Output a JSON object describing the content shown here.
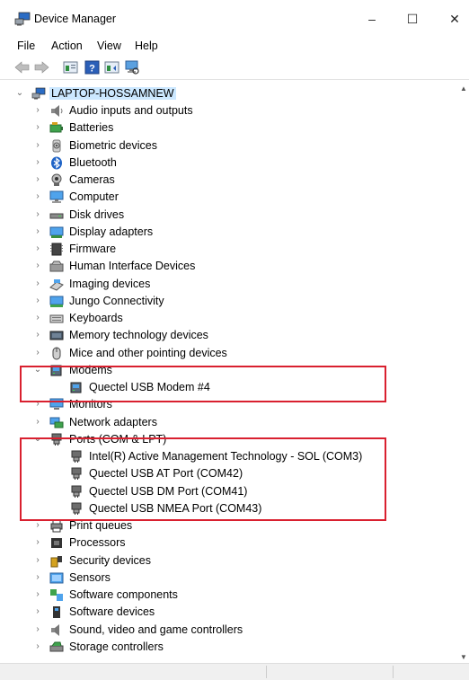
{
  "window": {
    "title": "Device Manager"
  },
  "menu": [
    "File",
    "Action",
    "View",
    "Help"
  ],
  "tree": {
    "root": "LAPTOP-HOSSAMNEW",
    "categories": [
      {
        "label": "Audio inputs and outputs",
        "icon": "speaker-icon"
      },
      {
        "label": "Batteries",
        "icon": "battery-icon"
      },
      {
        "label": "Biometric devices",
        "icon": "biometric-icon"
      },
      {
        "label": "Bluetooth",
        "icon": "bluetooth-icon"
      },
      {
        "label": "Cameras",
        "icon": "camera-icon"
      },
      {
        "label": "Computer",
        "icon": "computer-icon"
      },
      {
        "label": "Disk drives",
        "icon": "disk-drive-icon"
      },
      {
        "label": "Display adapters",
        "icon": "display-adapter-icon"
      },
      {
        "label": "Firmware",
        "icon": "firmware-icon"
      },
      {
        "label": "Human Interface Devices",
        "icon": "hid-icon"
      },
      {
        "label": "Imaging devices",
        "icon": "imaging-icon"
      },
      {
        "label": "Jungo Connectivity",
        "icon": "jungo-icon"
      },
      {
        "label": "Keyboards",
        "icon": "keyboard-icon"
      },
      {
        "label": "Memory technology devices",
        "icon": "memory-icon"
      },
      {
        "label": "Mice and other pointing devices",
        "icon": "mouse-icon"
      },
      {
        "label": "Modems",
        "icon": "modem-icon",
        "expanded": true,
        "children": [
          {
            "label": "Quectel USB Modem #4",
            "icon": "modem-icon"
          }
        ]
      },
      {
        "label": "Monitors",
        "icon": "monitor-icon"
      },
      {
        "label": "Network adapters",
        "icon": "network-adapter-icon"
      },
      {
        "label": "Ports (COM & LPT)",
        "icon": "port-icon",
        "expanded": true,
        "children": [
          {
            "label": "Intel(R) Active Management Technology - SOL (COM3)",
            "icon": "port-icon"
          },
          {
            "label": "Quectel USB AT Port (COM42)",
            "icon": "port-icon"
          },
          {
            "label": "Quectel USB DM Port (COM41)",
            "icon": "port-icon"
          },
          {
            "label": "Quectel USB NMEA Port (COM43)",
            "icon": "port-icon"
          }
        ]
      },
      {
        "label": "Print queues",
        "icon": "printer-icon"
      },
      {
        "label": "Processors",
        "icon": "processor-icon"
      },
      {
        "label": "Security devices",
        "icon": "security-icon"
      },
      {
        "label": "Sensors",
        "icon": "sensor-icon"
      },
      {
        "label": "Software components",
        "icon": "software-component-icon"
      },
      {
        "label": "Software devices",
        "icon": "software-device-icon"
      },
      {
        "label": "Sound, video and game controllers",
        "icon": "sound-icon"
      },
      {
        "label": "Storage controllers",
        "icon": "storage-icon"
      }
    ]
  },
  "colors": {
    "highlight_box": "#d9202f",
    "root_selection": "#cce8ff"
  }
}
